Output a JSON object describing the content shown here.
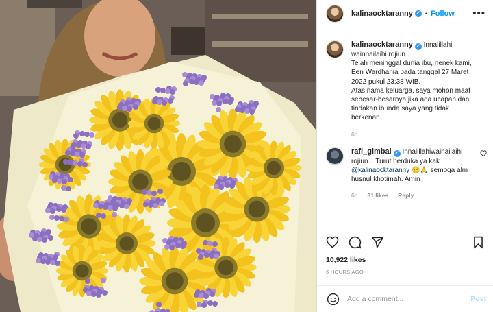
{
  "photo": {
    "alt": "Woman holding a bouquet of sunflowers and purple statice"
  },
  "header": {
    "username": "kalinaocktaranny",
    "verified_icon": "verified-badge-icon",
    "separator": "•",
    "follow_label": "Follow",
    "more_icon": "more-options-icon",
    "more_label": "•••"
  },
  "caption": {
    "username": "kalinaocktaranny",
    "text_1": "Innalillahi wainnailaihi rojiun..",
    "text_2": "Telah meninggal dunia ibu, nenek kami, Een Wardhania pada tanggal 27 Maret 2022 pukul 23:38 WIB.",
    "text_3": "Atas nama keluarga, saya mohon maaf sebesar-besarnya jika ada ucapan dan tindakan ibunda saya yang tidak berkenan.",
    "time": "6h"
  },
  "comment": {
    "username": "rafi_gimbal",
    "text_a": "Innalillahiwainailaihi rojiun... Turut berduka ya kak",
    "mention": "@kalinaocktaranny",
    "emoji": "😢🙏",
    "text_b": "semoga alm husnul khotimah. Amin",
    "time": "6h",
    "likes": "31 likes",
    "reply_label": "Reply"
  },
  "actions": {
    "icons": [
      "heart-icon",
      "comment-icon",
      "share-icon",
      "bookmark-icon"
    ],
    "likes": "10,922 likes",
    "time_ago": "6 HOURS AGO"
  },
  "add_comment": {
    "placeholder": "Add a comment...",
    "post_label": "Post",
    "emoji_icon": "emoji-icon"
  },
  "colors": {
    "link": "#0095f6",
    "post_disabled": "#b2dffc",
    "muted": "#8e8e8e",
    "verified": "#3897f0"
  }
}
